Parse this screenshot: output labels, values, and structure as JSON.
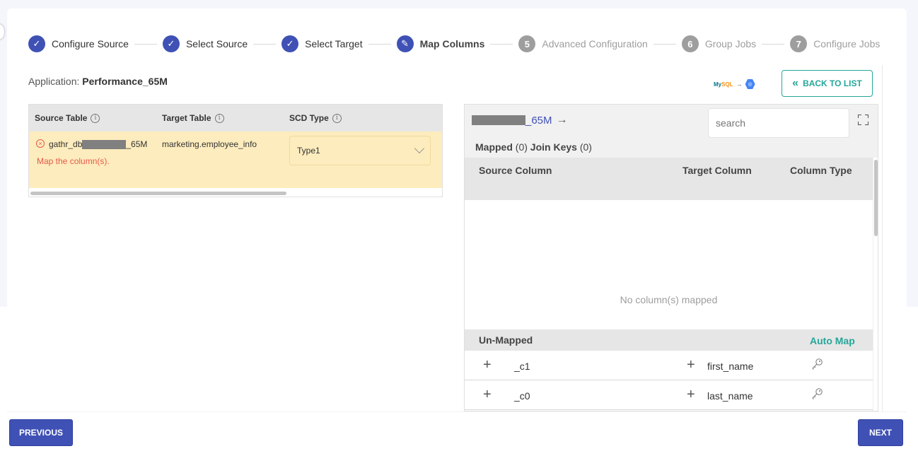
{
  "stepper": {
    "steps": [
      {
        "label": "Configure Source",
        "status": "done",
        "marker": "✓"
      },
      {
        "label": "Select Source",
        "status": "done",
        "marker": "✓"
      },
      {
        "label": "Select Target",
        "status": "done",
        "marker": "✓"
      },
      {
        "label": "Map Columns",
        "status": "active",
        "marker": "✎"
      },
      {
        "label": "Advanced Configuration",
        "status": "todo",
        "marker": "5"
      },
      {
        "label": "Group Jobs",
        "status": "todo",
        "marker": "6"
      },
      {
        "label": "Configure Jobs",
        "status": "todo",
        "marker": "7"
      }
    ]
  },
  "application": {
    "label": "Application:",
    "name": "Performance_65M"
  },
  "connectors": {
    "source": "MySQL",
    "arrow": "→",
    "target": "BigQuery"
  },
  "back_button": {
    "icon": "«",
    "label": "BACK TO LIST"
  },
  "table_list": {
    "headers": [
      "Source Table",
      "Target Table",
      "SCD Type"
    ],
    "info_icon": "i",
    "rows": [
      {
        "source_prefix": "gathr_db",
        "source_suffix": "_65M",
        "error_icon": "×",
        "error": "Map the column(s).",
        "target": "marketing.employee_info",
        "scd_type": "Type1"
      }
    ]
  },
  "mapping_panel": {
    "title_suffix": "_65M",
    "title_arrow": "→",
    "search_placeholder": "search",
    "mapped_label": "Mapped",
    "mapped_count": "(0)",
    "join_keys_label": "Join Keys",
    "join_keys_count": "(0)",
    "columns": [
      "Source Column",
      "Target Column",
      "Column Type"
    ],
    "empty_message": "No column(s) mapped",
    "unmapped_label": "Un-Mapped",
    "auto_map_label": "Auto Map",
    "unmapped_rows": [
      {
        "source": "_c1",
        "target": "first_name"
      },
      {
        "source": "_c0",
        "target": "last_name"
      }
    ]
  },
  "footer": {
    "previous_label": "PREVIOUS",
    "next_label": "NEXT"
  },
  "colors": {
    "primary": "#3f51b5",
    "accent": "#26a69a",
    "error": "#e65a4c",
    "warning_row": "#fdecbd"
  }
}
